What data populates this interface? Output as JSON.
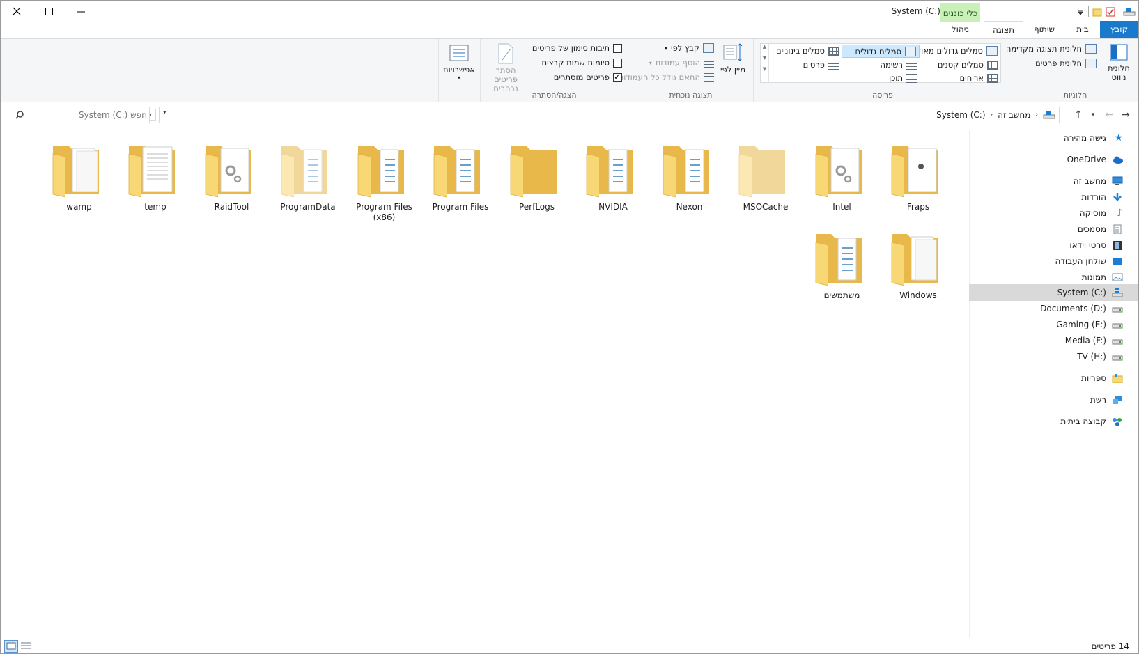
{
  "window": {
    "title": "System (C:)",
    "contextual_tab_group": "כלי כוננים",
    "caption_buttons": [
      "close-icon",
      "maximize-icon",
      "minimize-icon"
    ]
  },
  "tabs": [
    {
      "label": "קובץ",
      "active": false,
      "style": "file"
    },
    {
      "label": "בית",
      "active": false
    },
    {
      "label": "שיתוף",
      "active": false
    },
    {
      "label": "תצוגה",
      "active": true
    },
    {
      "label": "ניהול",
      "active": false
    }
  ],
  "ribbon": {
    "panes": {
      "label": "חלוניות",
      "nav_pane": "חלונית ניווט",
      "preview_pane": "חלונית תצוגה מקדימה",
      "details_pane": "חלונית פרטים"
    },
    "layout": {
      "label": "פריסה",
      "items": [
        "סמלים גדולים מאוד",
        "סמלים גדולים",
        "סמלים בינוניים",
        "סמלים קטנים",
        "רשימה",
        "פרטים",
        "אריחים",
        "תוכן"
      ],
      "selected": "סמלים גדולים"
    },
    "current_view": {
      "label": "תצוגה נוכחית",
      "sort_by": "מיין לפי",
      "group_by": "קבץ לפי",
      "add_columns": "הוסף עמודות",
      "size_columns": "התאם גודל כל העמודות"
    },
    "show_hide": {
      "label": "הצגה/הסתרה",
      "item_checkboxes": "תיבות סימון של פריטים",
      "file_extensions": "סיומות שמות קבצים",
      "hidden_items": "פריטים מוסתרים",
      "hide_selected": "הסתר פריטים נבחרים",
      "item_checkboxes_checked": false,
      "file_extensions_checked": false,
      "hidden_items_checked": true
    },
    "options": "אפשרויות"
  },
  "address": {
    "crumbs": [
      "מחשב זה",
      "System (C:)"
    ],
    "search_placeholder": "חפש System (C:)"
  },
  "navpane": [
    {
      "label": "גישה מהירה",
      "icon": "star-icon",
      "color": "#1a7fd4"
    },
    {
      "label": "OneDrive",
      "icon": "cloud-icon",
      "color": "#1a6ec7"
    },
    {
      "label": "מחשב זה",
      "icon": "computer-icon",
      "color": "#2a8fe0"
    },
    {
      "label": "הורדות",
      "icon": "download-icon",
      "color": "#1a7fd4"
    },
    {
      "label": "מוסיקה",
      "icon": "music-icon",
      "color": "#1a7fd4"
    },
    {
      "label": "מסמכים",
      "icon": "document-icon",
      "color": "#7a8a9a"
    },
    {
      "label": "סרטי וידאו",
      "icon": "video-icon",
      "color": "#333"
    },
    {
      "label": "שולחן העבודה",
      "icon": "desktop-icon",
      "color": "#1a7fd4"
    },
    {
      "label": "תמונות",
      "icon": "pictures-icon",
      "color": "#6a8fb0"
    },
    {
      "label": "System (C:)",
      "icon": "windows-drive-icon",
      "color": "#1a7fd4",
      "selected": true
    },
    {
      "label": "Documents (D:)",
      "icon": "drive-icon",
      "color": "#777"
    },
    {
      "label": "Gaming (E:)",
      "icon": "drive-icon",
      "color": "#777"
    },
    {
      "label": "Media (F:)",
      "icon": "drive-icon",
      "color": "#777"
    },
    {
      "label": "TV (H:)",
      "icon": "drive-icon",
      "color": "#777"
    },
    {
      "label": "ספריות",
      "icon": "libraries-icon",
      "color": "#e8b84a"
    },
    {
      "label": "רשת",
      "icon": "network-icon",
      "color": "#2a8fe0"
    },
    {
      "label": "קבוצה ביתית",
      "icon": "homegroup-icon",
      "color": "#2aa84a"
    }
  ],
  "folders": [
    {
      "name": "Fraps",
      "overlay": "app"
    },
    {
      "name": "Intel",
      "overlay": "gears"
    },
    {
      "name": "MSOCache",
      "overlay": "empty-faded"
    },
    {
      "name": "Nexon",
      "overlay": "files"
    },
    {
      "name": "NVIDIA",
      "overlay": "files"
    },
    {
      "name": "PerfLogs",
      "overlay": "empty"
    },
    {
      "name": "Program Files",
      "overlay": "files"
    },
    {
      "name": "Program Files\n(x86)",
      "overlay": "files"
    },
    {
      "name": "ProgramData",
      "overlay": "files-faded"
    },
    {
      "name": "RaidTool",
      "overlay": "gears"
    },
    {
      "name": "temp",
      "overlay": "doc"
    },
    {
      "name": "wamp",
      "overlay": "paper"
    },
    {
      "name": "Windows",
      "overlay": "paper"
    },
    {
      "name": "משתמשים",
      "overlay": "files"
    }
  ],
  "status": {
    "count": "14 פריטים"
  },
  "colors": {
    "accent": "#1979ca",
    "folder": "#f8d775",
    "folder_back": "#e8b84a",
    "selection": "#cce8ff"
  }
}
